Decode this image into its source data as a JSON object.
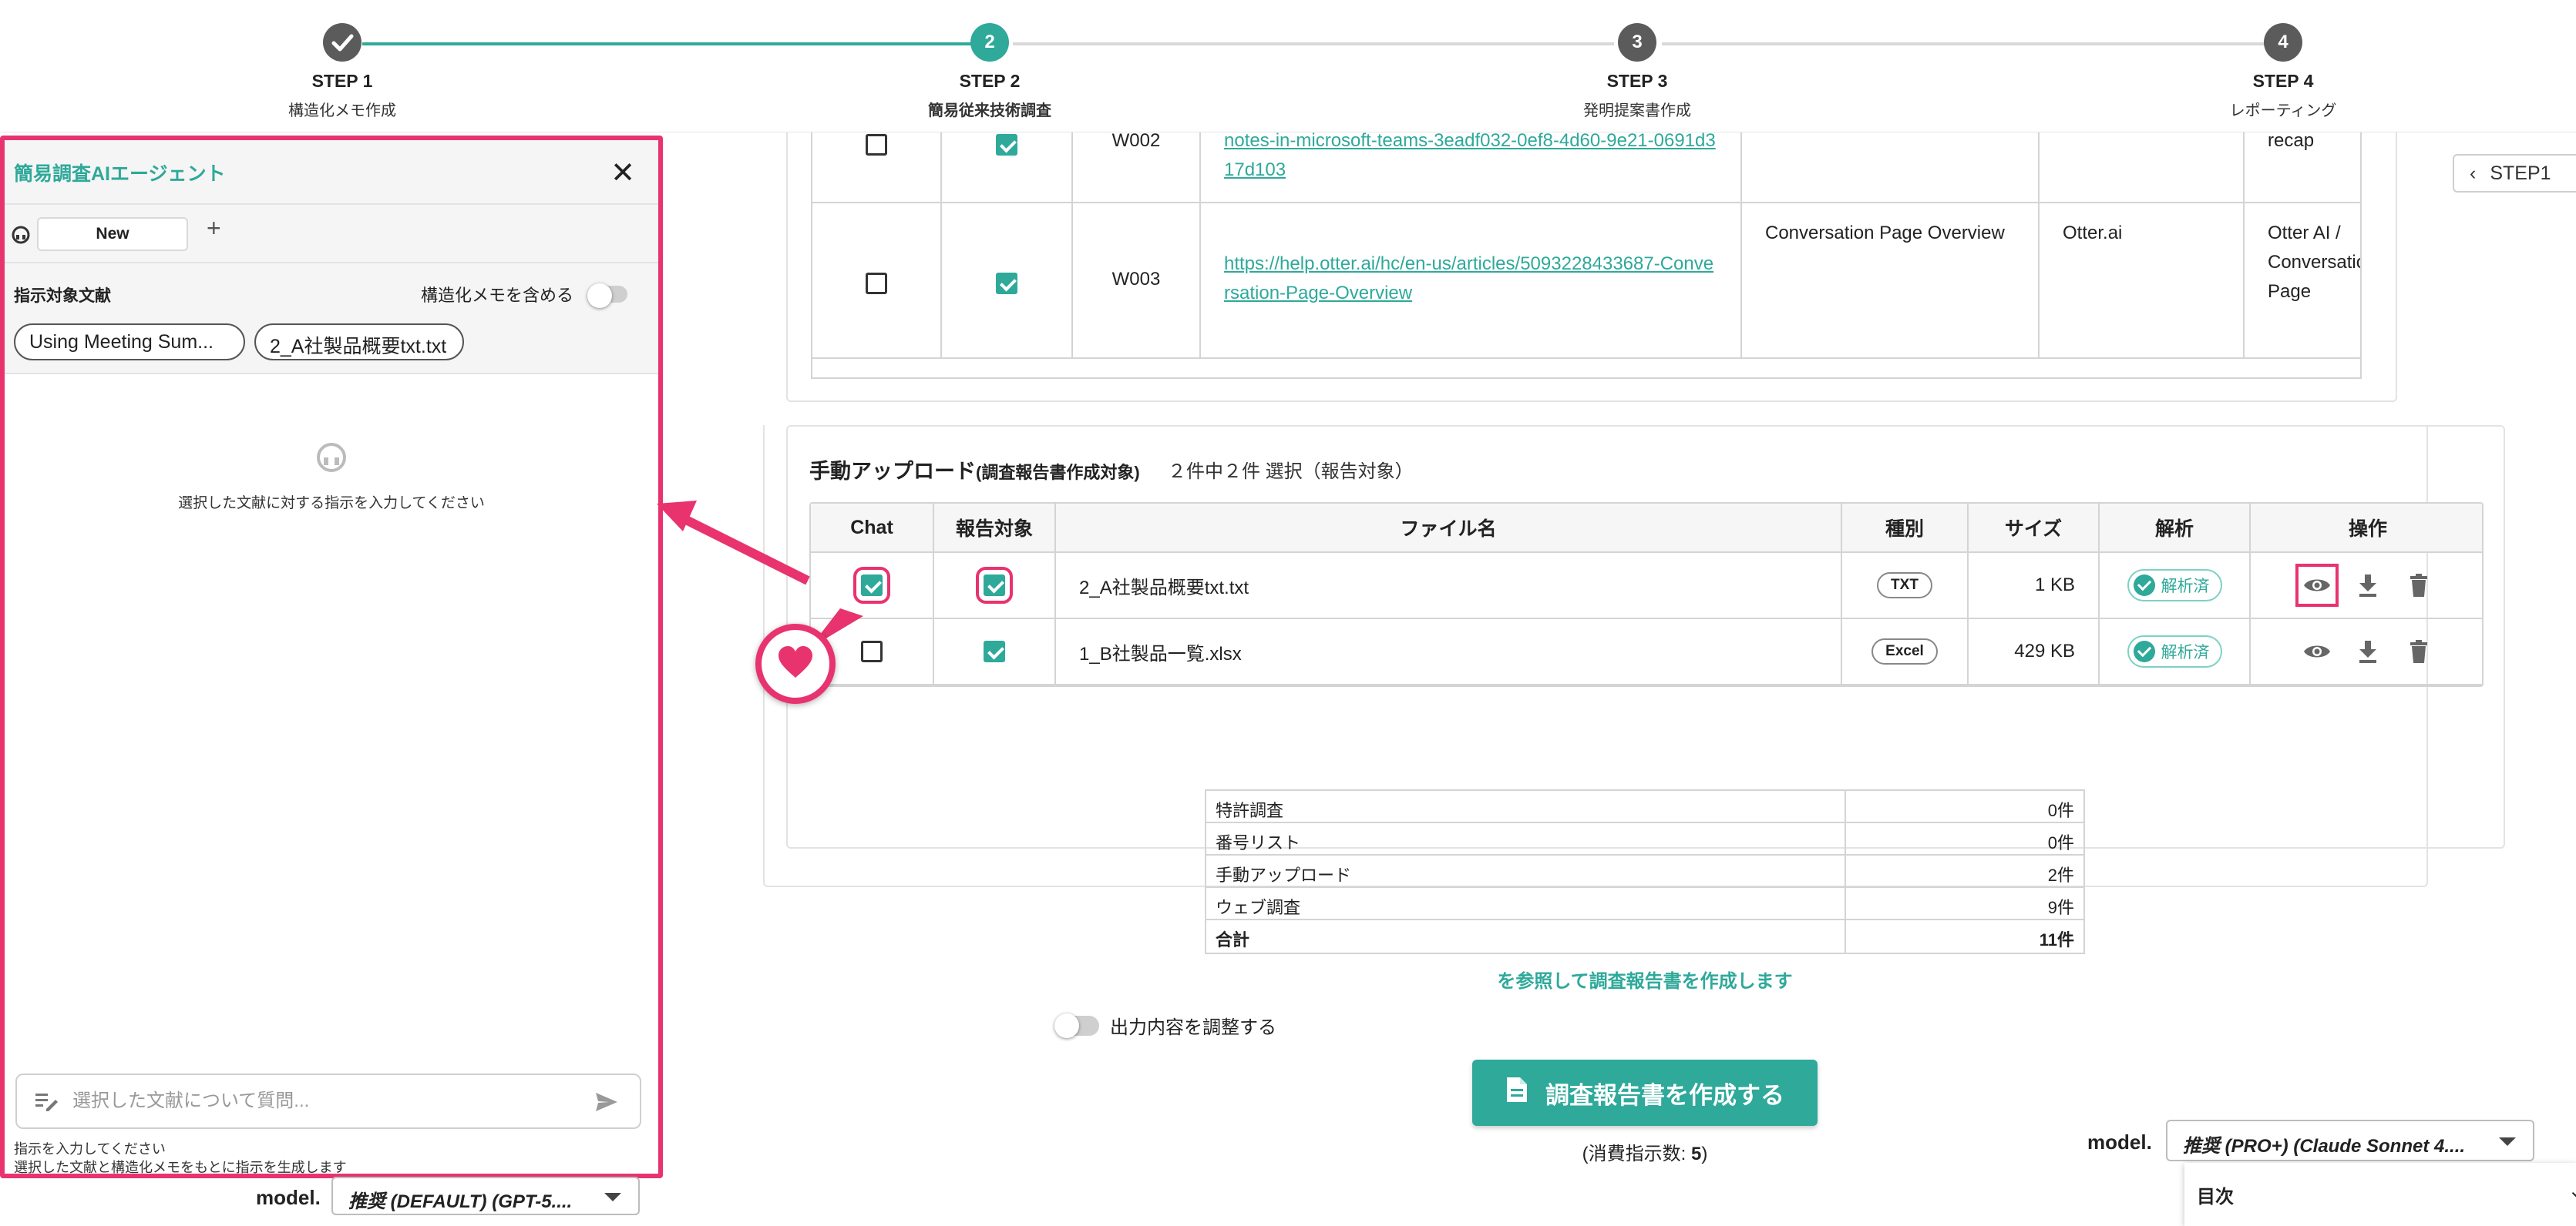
{
  "stepper": {
    "steps": [
      {
        "num": "",
        "title": "STEP 1",
        "sub": "構造化メモ作成",
        "state": "done"
      },
      {
        "num": "2",
        "title": "STEP 2",
        "sub": "簡易従来技術調査",
        "state": "active"
      },
      {
        "num": "3",
        "title": "STEP 3",
        "sub": "発明提案書作成",
        "state": "pending"
      },
      {
        "num": "4",
        "title": "STEP 4",
        "sub": "レポーティング",
        "state": "pending"
      }
    ]
  },
  "web_table": {
    "rows": [
      {
        "id": "W002",
        "url": "notes-in-microsoft-teams-3eadf032-0ef8-4d60-9e21-0691d317d103",
        "title": "",
        "source": "",
        "name": "recap",
        "chat": false,
        "report": true
      },
      {
        "id": "W003",
        "url": "https://help.otter.ai/hc/en-us/articles/5093228433687-Conversation-Page-Overview",
        "title": "Conversation Page Overview",
        "source": "Otter.ai",
        "name": "Otter AI / Conversation Page",
        "chat": false,
        "report": true
      }
    ],
    "step1_tab": "STEP1"
  },
  "upload": {
    "title": "手動アップロード",
    "title_note": "(調査報告書作成対象)",
    "count": "２件中２件 選択（報告対象）",
    "headers": {
      "chat": "Chat",
      "report": "報告対象",
      "filename": "ファイル名",
      "type": "種別",
      "size": "サイズ",
      "analysis": "解析",
      "ops": "操作"
    },
    "rows": [
      {
        "filename": "2_A社製品概要txt.txt",
        "type": "TXT",
        "size": "1 KB",
        "status": "解析済",
        "chat": true,
        "report": true
      },
      {
        "filename": "1_B社製品一覧.xlsx",
        "type": "Excel",
        "size": "429 KB",
        "status": "解析済",
        "chat": false,
        "report": true
      }
    ]
  },
  "summary": {
    "rows": [
      {
        "label": "特許調査",
        "value": "0件"
      },
      {
        "label": "番号リスト",
        "value": "0件"
      },
      {
        "label": "手動アップロード",
        "value": "2件"
      },
      {
        "label": "ウェブ調査",
        "value": "9件"
      },
      {
        "label": "合計",
        "value": "11件"
      }
    ],
    "note": "を参照して調査報告書を作成します"
  },
  "adjust_label": "出力内容を調整する",
  "create_button": "調査報告書を作成する",
  "consume": {
    "prefix": "(消費指示数: ",
    "value": "5",
    "suffix": ")"
  },
  "model_right": {
    "label": "model.",
    "value": "推奨 (PRO+) (Claude Sonnet 4...."
  },
  "toc": "目次",
  "chat_panel": {
    "title": "簡易調査AIエージェント",
    "tab": "New",
    "plus": "+",
    "docs_label": "指示対象文献",
    "include_memo": "構造化メモを含める",
    "chips": [
      "Using Meeting Sum...",
      "2_A社製品概要txt.txt"
    ],
    "empty_text": "選択した文献に対する指示を入力してください",
    "input_placeholder": "選択した文献について質問...",
    "hint1": "指示を入力してください",
    "hint2": "選択した文献と構造化メモをもとに指示を生成します"
  },
  "model_left": {
    "label": "model.",
    "value": "推奨 (DEFAULT) (GPT-5...."
  },
  "colors": {
    "accent": "#2ea99a",
    "highlight": "#e8336f"
  }
}
